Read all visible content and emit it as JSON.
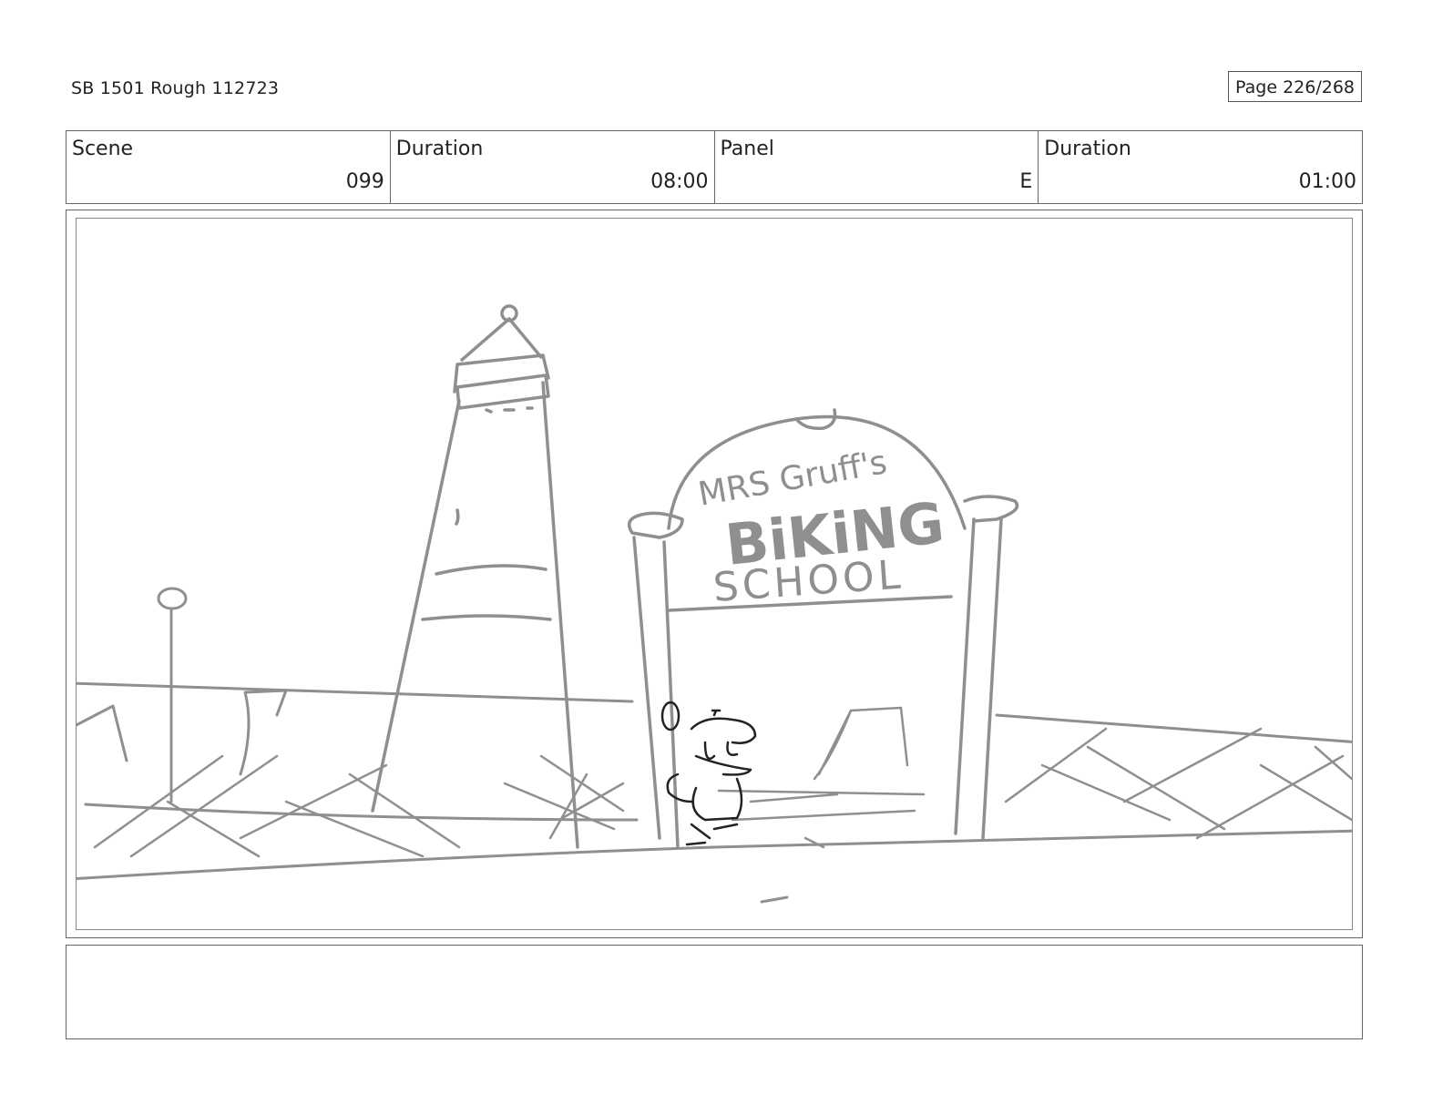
{
  "header": {
    "title": "SB 1501 Rough 112723",
    "page": "Page 226/268"
  },
  "info": {
    "scene_label": "Scene",
    "scene_value": "099",
    "scene_duration_label": "Duration",
    "scene_duration_value": "08:00",
    "panel_label": "Panel",
    "panel_value": "E",
    "panel_duration_label": "Duration",
    "panel_duration_value": "01:00"
  },
  "panel": {
    "sign_line1": "MRS Gruff's",
    "sign_line2": "BiKiNG",
    "sign_line3": "SCHOOL",
    "sketch_color": "#8f8f8f"
  },
  "notes": {
    "text": ""
  }
}
